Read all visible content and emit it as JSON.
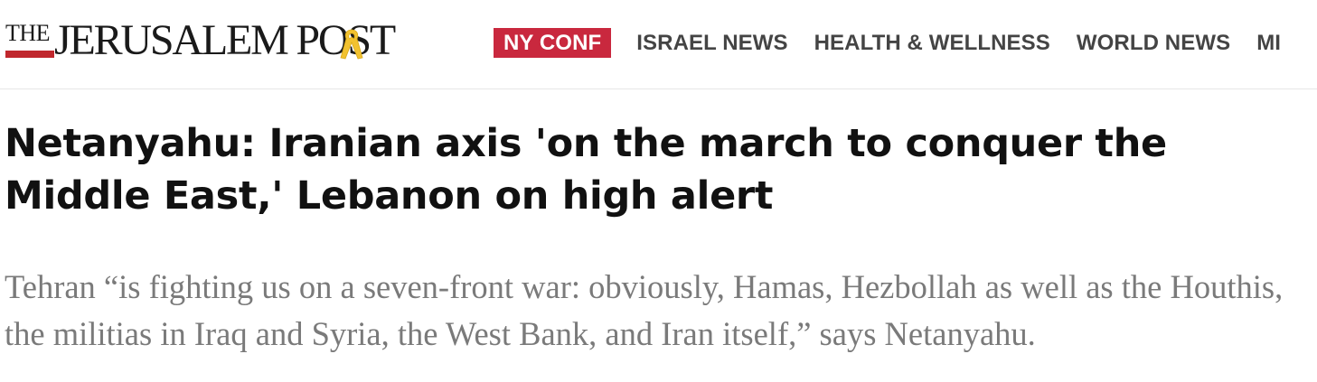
{
  "header": {
    "logo": {
      "the": "THE",
      "name": "JERUSALEM POST"
    },
    "ribbon_icon": "yellow-ribbon-icon",
    "nav": {
      "items": [
        {
          "label": "NY CONF",
          "highlighted": true
        },
        {
          "label": "ISRAEL NEWS"
        },
        {
          "label": "HEALTH & WELLNESS"
        },
        {
          "label": "WORLD NEWS"
        },
        {
          "label": "MI"
        }
      ]
    }
  },
  "article": {
    "headline": "Netanyahu: Iranian axis 'on the march to conquer the Middle East,' Lebanon on high alert",
    "subheadline": "Tehran “is fighting us on a seven-front war: obviously, Hamas, Hezbollah as well as the Houthis, the militias in Iraq and Syria, the West Bank, and Iran itself,” says Netanyahu."
  },
  "colors": {
    "brand_red": "#c0272d",
    "highlight_red": "#c9283e",
    "nav_text": "#444444",
    "ribbon_yellow": "#f2c230",
    "subhead_gray": "#7a7a7a"
  }
}
